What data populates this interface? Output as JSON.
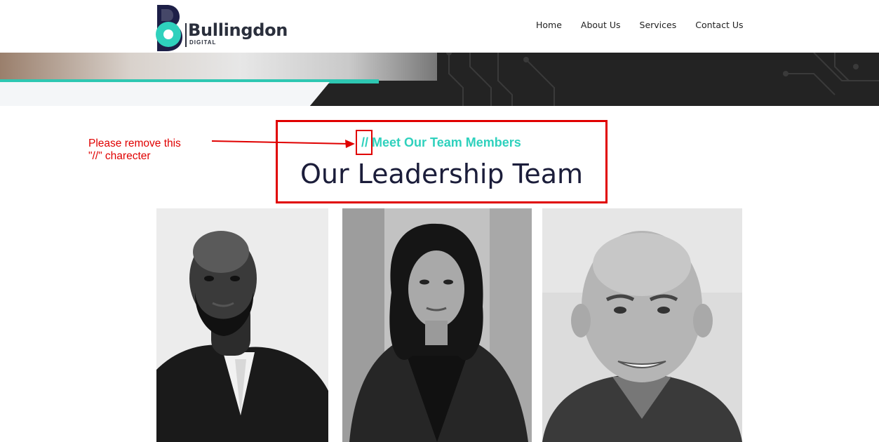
{
  "brand": {
    "name": "Bullingdon",
    "sub": "DIGITAL"
  },
  "nav": {
    "items": [
      "Home",
      "About Us",
      "Services",
      "Contact Us"
    ]
  },
  "section": {
    "slashes": "//",
    "subtitle": "Meet Our Team Members",
    "title": "Our Leadership Team"
  },
  "annotation": {
    "line1": "Please remove this",
    "line2": "\"//\" charecter"
  },
  "colors": {
    "accent": "#2fd1bd",
    "title": "#1b1d3a",
    "annotation": "#e00000",
    "hero_dark": "#232323"
  },
  "team": {
    "count": 3
  }
}
